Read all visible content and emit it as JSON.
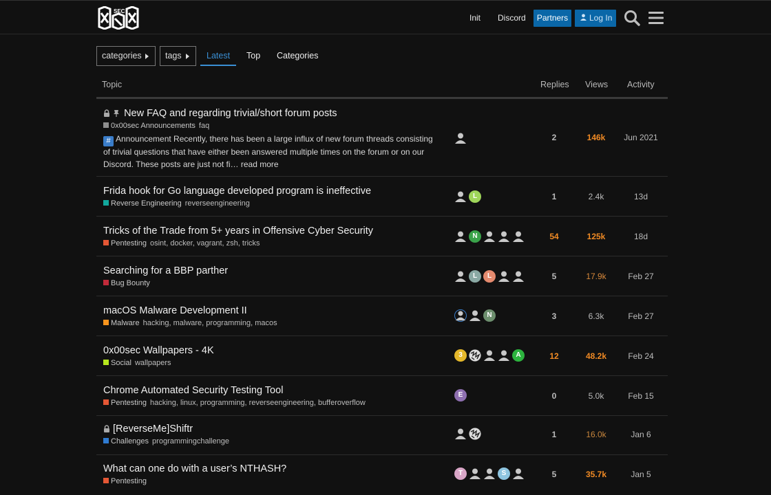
{
  "header": {
    "nav": [
      "Init",
      "Discord"
    ],
    "partners_label": "Partners",
    "login_label": "Log In"
  },
  "filters": {
    "categories_label": "categories",
    "tags_label": "tags",
    "tabs": [
      "Latest",
      "Top",
      "Categories"
    ]
  },
  "table": {
    "headers": {
      "topic": "Topic",
      "replies": "Replies",
      "views": "Views",
      "activity": "Activity"
    }
  },
  "topics": [
    {
      "title": "New FAQ and regarding trivial/short forum posts",
      "category": "0x00sec Announcements",
      "category_color": "#8f8f8f",
      "tags": "faq",
      "excerpt": "Announcement Recently, there has been a large influx of new forum threads consisting of trivial questions that have either been answered multiple times on the forum or on our Discord. These posts are just not fi…",
      "read_more": "read more",
      "replies": "2",
      "views": "146k",
      "activity": "Jun 2021"
    },
    {
      "title": "Frida hook for Go language developed program is ineffective",
      "category": "Reverse Engineering",
      "category_color": "#12a89d",
      "tags": "reverseengineering",
      "replies": "1",
      "views": "2.4k",
      "activity": "13d"
    },
    {
      "title": "Tricks of the Trade from 5+ years in Offensive Cyber Security",
      "category": "Pentesting",
      "category_color": "#e45735",
      "tags": "osint, docker, vagrant, zsh, tricks",
      "replies": "54",
      "views": "125k",
      "activity": "18d"
    },
    {
      "title": "Searching for a BBP parther",
      "category": "Bug Bounty",
      "category_color": "#c12a3a",
      "tags": "",
      "replies": "5",
      "views": "17.9k",
      "activity": "Feb 27"
    },
    {
      "title": "macOS Malware Development II",
      "category": "Malware",
      "category_color": "#f7941d",
      "tags": "hacking, malware, programming, macos",
      "replies": "3",
      "views": "6.3k",
      "activity": "Feb 27"
    },
    {
      "title": "0x00sec Wallpapers - 4K",
      "category": "Social",
      "category_color": "#b5e61d",
      "tags": "wallpapers",
      "replies": "12",
      "views": "48.2k",
      "activity": "Feb 24"
    },
    {
      "title": "Chrome Automated Security Testing Tool",
      "category": "Pentesting",
      "category_color": "#e45735",
      "tags": "hacking, linux, programming, reverseengineering, bufferoverflow",
      "replies": "0",
      "views": "5.0k",
      "activity": "Feb 15"
    },
    {
      "title": "[ReverseMe]Shiftr",
      "category": "Challenges",
      "category_color": "#2f7bd1",
      "tags": "programmingchallenge",
      "replies": "1",
      "views": "16.0k",
      "activity": "Jan 6"
    },
    {
      "title": "What can one do with a user’s NTHASH?",
      "category": "Pentesting",
      "category_color": "#e45735",
      "tags": "",
      "replies": "5",
      "views": "35.7k",
      "activity": "Jan 5"
    }
  ],
  "avatars": {
    "r1": [
      ""
    ],
    "r2": [
      "",
      "L"
    ],
    "r3": [
      "",
      "N",
      "",
      "",
      ""
    ],
    "r4": [
      "",
      "L",
      "L",
      "",
      ""
    ],
    "r5": [
      "",
      "",
      "N"
    ],
    "r6": [
      "3",
      "",
      "",
      "",
      "A"
    ],
    "r7": [
      "E"
    ],
    "r8": [
      "",
      ""
    ],
    "r9": [
      "T",
      "",
      "",
      "S",
      ""
    ]
  },
  "colors": {
    "accent": "#0a67a8",
    "link_active": "#3a8fd4",
    "hot_views": "#f08a24",
    "warm_views": "#d9893b"
  }
}
